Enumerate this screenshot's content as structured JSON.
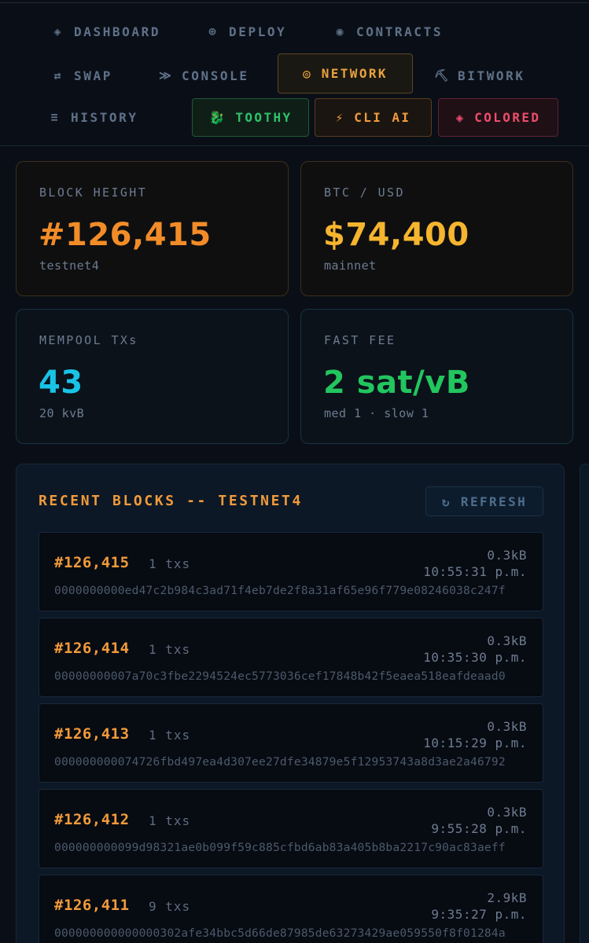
{
  "nav": {
    "items": [
      {
        "label": "DASHBOARD",
        "icon": "◈"
      },
      {
        "label": "DEPLOY",
        "icon": "⊕"
      },
      {
        "label": "CONTRACTS",
        "icon": "◉"
      },
      {
        "label": "SWAP",
        "icon": "⇄"
      },
      {
        "label": "CONSOLE",
        "icon": "≫"
      },
      {
        "label": "NETWORK",
        "icon": "◎"
      },
      {
        "label": "BITWORK",
        "icon": "⛏"
      },
      {
        "label": "HISTORY",
        "icon": "≡"
      }
    ],
    "pills": [
      {
        "label": "TOOTHY",
        "icon": "🐉"
      },
      {
        "label": "CLI AI",
        "icon": "⚡"
      },
      {
        "label": "COLORED",
        "icon": "◈"
      }
    ]
  },
  "stats": {
    "block_height": {
      "label": "BLOCK HEIGHT",
      "value": "#126,415",
      "sub": "testnet4"
    },
    "btc_usd": {
      "label": "BTC / USD",
      "value": "$74,400",
      "sub": "mainnet"
    },
    "mempool": {
      "label": "MEMPOOL TXs",
      "value": "43",
      "sub": "20 kvB"
    },
    "fast_fee": {
      "label": "FAST FEE",
      "value": "2 sat/vB",
      "sub": "med 1 · slow 1"
    }
  },
  "recent_blocks": {
    "title": "RECENT BLOCKS -- TESTNET4",
    "refresh_label": "REFRESH",
    "refresh_icon": "↻",
    "blocks": [
      {
        "height": "#126,415",
        "txs": "1 txs",
        "size": "0.3kB",
        "time": "10:55:31 p.m.",
        "hash": "0000000000ed47c2b984c3ad71f4eb7de2f8a31af65e96f779e08246038c247f"
      },
      {
        "height": "#126,414",
        "txs": "1 txs",
        "size": "0.3kB",
        "time": "10:35:30 p.m.",
        "hash": "00000000007a70c3fbe2294524ec5773036cef17848b42f5eaea518eafdeaad0"
      },
      {
        "height": "#126,413",
        "txs": "1 txs",
        "size": "0.3kB",
        "time": "10:15:29 p.m.",
        "hash": "000000000074726fbd497ea4d307ee27dfe34879e5f12953743a8d3ae2a46792"
      },
      {
        "height": "#126,412",
        "txs": "1 txs",
        "size": "0.3kB",
        "time": "9:55:28 p.m.",
        "hash": "000000000099d98321ae0b099f59c885cfbd6ab83a405b8ba2217c90ac83aeff"
      },
      {
        "height": "#126,411",
        "txs": "9 txs",
        "size": "2.9kB",
        "time": "9:35:27 p.m.",
        "hash": "000000000000000302afe34bbc5d66de87985de63273429ae059550f8f01284a"
      }
    ]
  }
}
